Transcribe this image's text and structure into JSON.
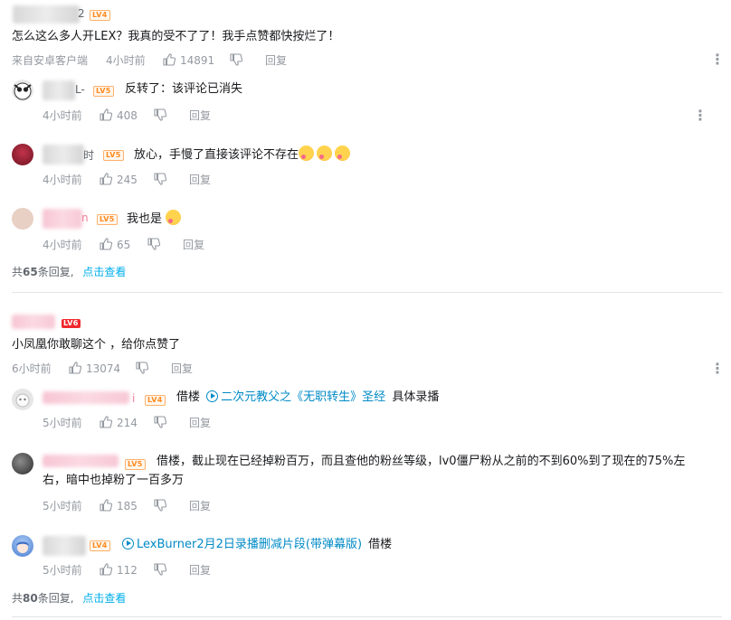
{
  "c1": {
    "name_suffix": "2",
    "level": "LV4",
    "text": "怎么这么多人开LEX？我真的受不了了！我手点赞都快按烂了！",
    "source": "来自安卓客户端",
    "time": "4小时前",
    "likes": "14891",
    "reply": "回复",
    "replies": [
      {
        "name_suffix": "L-",
        "level": "LV5",
        "text": "反转了：该评论已消失",
        "time": "4小时前",
        "likes": "408",
        "reply": "回复"
      },
      {
        "name_suffix": "时",
        "level": "LV5",
        "text": "放心，手慢了直接该评论不存在",
        "time": "4小时前",
        "likes": "245",
        "reply": "回复"
      },
      {
        "name_suffix": "n",
        "level": "LV5",
        "text": "我也是",
        "time": "4小时前",
        "likes": "65",
        "reply": "回复"
      }
    ],
    "summary_prefix": "共",
    "summary_count": "65",
    "summary_suffix": "条回复,",
    "view_more": "点击查看"
  },
  "c2": {
    "level": "LV6",
    "text": "小凤凰你敢聊这个 ，给你点赞了",
    "time": "6小时前",
    "likes": "13074",
    "reply": "回复",
    "replies": [
      {
        "name_suffix": "i",
        "level": "LV4",
        "prefix": "借楼",
        "video": "二次元教父之《无职转生》圣经",
        "suffix": "具体录播",
        "time": "5小时前",
        "likes": "214",
        "reply": "回复"
      },
      {
        "level": "LV5",
        "text_line1": "借楼，截止现在已经掉粉百万，而且查他的粉丝等级，lv0僵尸粉从之前的不到60%到了现在的75%左",
        "text_line2": "右，暗中也掉粉了一百多万",
        "time": "5小时前",
        "likes": "185",
        "reply": "回复"
      },
      {
        "level": "LV4",
        "video": "LexBurner2月2日录播删减片段(带弹幕版)",
        "suffix": "借楼",
        "time": "5小时前",
        "likes": "112",
        "reply": "回复"
      }
    ],
    "summary_prefix": "共",
    "summary_count": "80",
    "summary_suffix": "条回复,",
    "view_more": "点击查看"
  },
  "icons": {
    "like": "thumbs-up-icon",
    "dislike": "thumbs-down-icon",
    "more": "kebab-menu-icon",
    "play": "play-circle-icon",
    "emoji": "emoji-face-icon"
  },
  "colors": {
    "link": "#00aeec",
    "meta": "#9499a0",
    "level_orange": "#ff8a1f",
    "level_red": "#f0282d"
  }
}
